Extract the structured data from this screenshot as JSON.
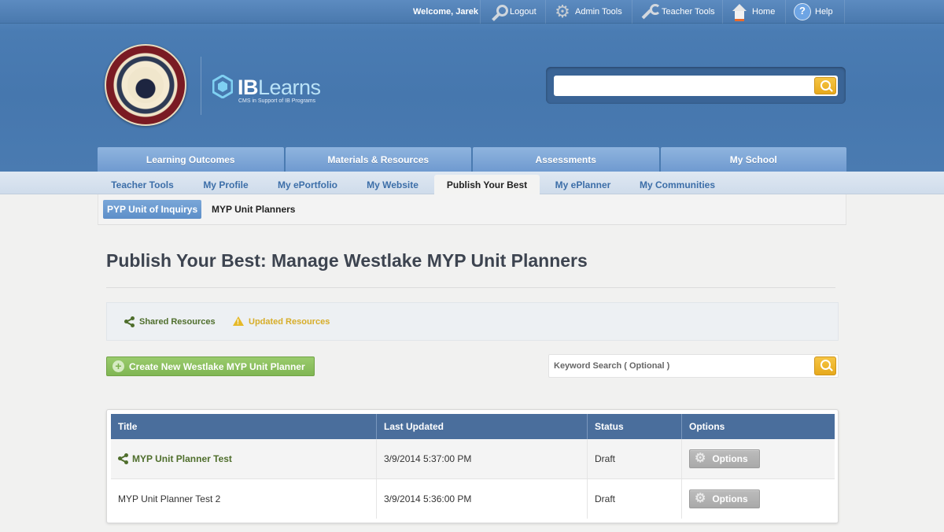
{
  "topbar": {
    "welcome": "Welcome, Jarek",
    "logout": "Logout",
    "admin_tools": "Admin Tools",
    "teacher_tools": "Teacher Tools",
    "home": "Home",
    "help": "Help",
    "help_glyph": "?"
  },
  "brand": {
    "ib": "IB",
    "learns": "Learns",
    "tagline": "CMS in Support of IB Programs"
  },
  "header_search": {
    "placeholder": ""
  },
  "main_nav": [
    "Learning Outcomes",
    "Materials & Resources",
    "Assessments",
    "My School"
  ],
  "sub_nav": [
    "Teacher Tools",
    "My Profile",
    "My ePortfolio",
    "My Website",
    "Publish Your Best",
    "My ePlanner",
    "My Communities"
  ],
  "sub_nav_active": "Publish Your Best",
  "tertiary_nav": {
    "active": "PYP Unit of Inquirys",
    "other": "MYP Unit Planners"
  },
  "page": {
    "title": "Publish Your Best: Manage Westlake MYP Unit Planners",
    "shared_resources": "Shared Resources",
    "updated_resources": "Updated Resources",
    "create_button": "Create New Westlake MYP Unit Planner",
    "keyword_placeholder": "Keyword Search ( Optional )"
  },
  "table": {
    "headers": [
      "Title",
      "Last Updated",
      "Status",
      "Options"
    ],
    "rows": [
      {
        "title": "MYP Unit Planner Test",
        "shared": true,
        "last_updated": "3/9/2014 5:37:00 PM",
        "status": "Draft",
        "option": "Options"
      },
      {
        "title": "MYP Unit Planner Test 2",
        "shared": false,
        "last_updated": "3/9/2014 5:36:00 PM",
        "status": "Draft",
        "option": "Options"
      }
    ]
  },
  "colors": {
    "header_blue": "#4677ae",
    "accent_green": "#80b653",
    "link_green": "#4f6e2c",
    "warning_yellow": "#d7ad29",
    "search_button": "#e7a91c",
    "table_header": "#4a6e9c"
  },
  "icons": {
    "logout": "key-icon",
    "admin_tools": "gear-icon",
    "teacher_tools": "wrench-icon",
    "home": "home-icon",
    "help": "help-icon",
    "search": "search-icon",
    "shared": "share-icon",
    "updated": "warning-icon",
    "create": "plus-icon",
    "options": "cog-icon"
  }
}
